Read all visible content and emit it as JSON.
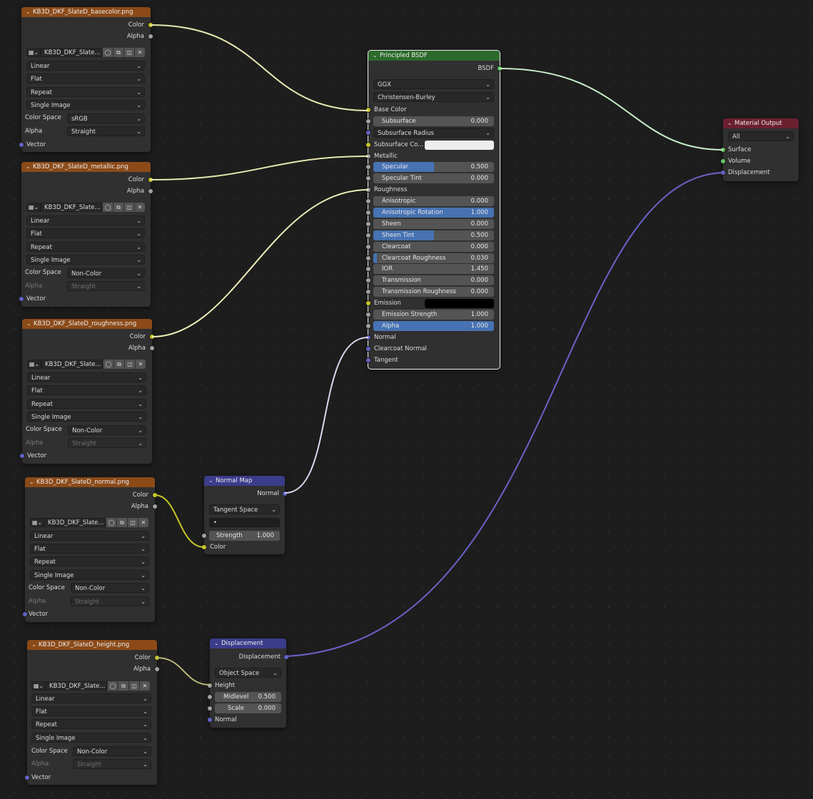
{
  "image_nodes": [
    {
      "title": "KB3D_DKF_SlateD_basecolor.png",
      "outputs": {
        "color": "Color",
        "alpha": "Alpha"
      },
      "image_name": "KB3D_DKF_Slate...",
      "interpolation": "Linear",
      "projection": "Flat",
      "extension": "Repeat",
      "source": "Single Image",
      "color_space_label": "Color Space",
      "color_space": "sRGB",
      "alpha_label": "Alpha",
      "alpha_mode": "Straight",
      "input_vector": "Vector"
    },
    {
      "title": "KB3D_DKF_SlateD_metallic.png",
      "outputs": {
        "color": "Color",
        "alpha": "Alpha"
      },
      "image_name": "KB3D_DKF_Slate...",
      "interpolation": "Linear",
      "projection": "Flat",
      "extension": "Repeat",
      "source": "Single Image",
      "color_space_label": "Color Space",
      "color_space": "Non-Color",
      "alpha_label": "Alpha",
      "alpha_mode": "Straight",
      "input_vector": "Vector"
    },
    {
      "title": "KB3D_DKF_SlateD_roughness.png",
      "outputs": {
        "color": "Color",
        "alpha": "Alpha"
      },
      "image_name": "KB3D_DKF_Slate...",
      "interpolation": "Linear",
      "projection": "Flat",
      "extension": "Repeat",
      "source": "Single Image",
      "color_space_label": "Color Space",
      "color_space": "Non-Color",
      "alpha_label": "Alpha",
      "alpha_mode": "Straight",
      "input_vector": "Vector"
    },
    {
      "title": "KB3D_DKF_SlateD_normal.png",
      "outputs": {
        "color": "Color",
        "alpha": "Alpha"
      },
      "image_name": "KB3D_DKF_Slate...",
      "interpolation": "Linear",
      "projection": "Flat",
      "extension": "Repeat",
      "source": "Single Image",
      "color_space_label": "Color Space",
      "color_space": "Non-Color",
      "alpha_label": "Alpha",
      "alpha_mode": "Straight",
      "input_vector": "Vector"
    },
    {
      "title": "KB3D_DKF_SlateD_height.png",
      "outputs": {
        "color": "Color",
        "alpha": "Alpha"
      },
      "image_name": "KB3D_DKF_Slate...",
      "interpolation": "Linear",
      "projection": "Flat",
      "extension": "Repeat",
      "source": "Single Image",
      "color_space_label": "Color Space",
      "color_space": "Non-Color",
      "alpha_label": "Alpha",
      "alpha_mode": "Straight",
      "input_vector": "Vector"
    }
  ],
  "principled": {
    "title": "Principled BSDF",
    "output": "BSDF",
    "distribution": "GGX",
    "subsurface_method": "Christensen-Burley",
    "base_color": "Base Color",
    "subsurface": {
      "label": "Subsurface",
      "value": "0.000",
      "fill": 0
    },
    "subsurface_radius": "Subsurface Radius",
    "subsurface_color": "Subsurface Co...",
    "metallic": "Metallic",
    "specular": {
      "label": "Specular",
      "value": "0.500",
      "fill": 0.5
    },
    "specular_tint": {
      "label": "Specular Tint",
      "value": "0.000",
      "fill": 0
    },
    "roughness": "Roughness",
    "anisotropic": {
      "label": "Anisotropic",
      "value": "0.000",
      "fill": 0
    },
    "anisotropic_rotation": {
      "label": "Anisotropic Rotation",
      "value": "1.000",
      "fill": 1
    },
    "sheen": {
      "label": "Sheen",
      "value": "0.000",
      "fill": 0
    },
    "sheen_tint": {
      "label": "Sheen Tint",
      "value": "0.500",
      "fill": 0.5
    },
    "clearcoat": {
      "label": "Clearcoat",
      "value": "0.000",
      "fill": 0
    },
    "clearcoat_roughness": {
      "label": "Clearcoat Roughness",
      "value": "0.030",
      "fill": 0.03
    },
    "ior": {
      "label": "IOR",
      "value": "1.450",
      "fill": 0
    },
    "transmission": {
      "label": "Transmission",
      "value": "0.000",
      "fill": 0
    },
    "transmission_roughness": {
      "label": "Transmission Roughness",
      "value": "0.000",
      "fill": 0
    },
    "emission": "Emission",
    "emission_strength": {
      "label": "Emission Strength",
      "value": "1.000",
      "fill": 0
    },
    "alpha": {
      "label": "Alpha",
      "value": "1.000",
      "fill": 1
    },
    "normal": "Normal",
    "clearcoat_normal": "Clearcoat Normal",
    "tangent": "Tangent"
  },
  "material_output": {
    "title": "Material Output",
    "target": "All",
    "surface": "Surface",
    "volume": "Volume",
    "displacement": "Displacement"
  },
  "normal_map": {
    "title": "Normal Map",
    "output": "Normal",
    "space": "Tangent Space",
    "uv_map": "•",
    "strength": {
      "label": "Strength",
      "value": "1.000"
    },
    "input_color": "Color"
  },
  "displacement": {
    "title": "Displacement",
    "output": "Displacement",
    "space": "Object Space",
    "height": "Height",
    "midlevel": {
      "label": "Midlevel",
      "value": "0.500"
    },
    "scale": {
      "label": "Scale",
      "value": "0.000"
    },
    "normal": "Normal"
  },
  "colors": {
    "image_header": "#8b4a18",
    "shader_header": "#2c6a2c",
    "output_header": "#6b2030",
    "vector_header": "#3c3c8c",
    "slider_fill": "#4772b3",
    "socket_color": "#c7c729",
    "socket_float": "#a1a1a1",
    "socket_vector": "#6363c7",
    "socket_shader": "#63c763",
    "subsurface_color_swatch": "#eeeeee",
    "emission_color_swatch": "#000000"
  }
}
